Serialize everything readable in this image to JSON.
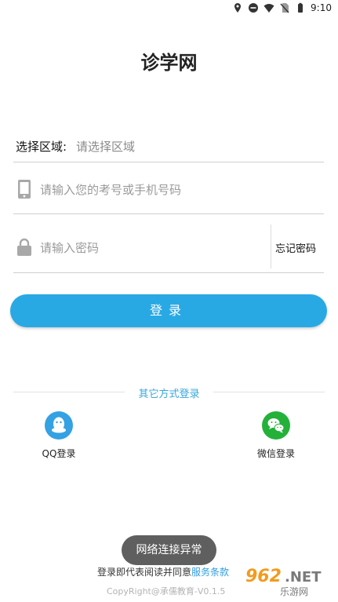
{
  "status_bar": {
    "time": "9:10",
    "icons": [
      "location-icon",
      "do-not-disturb-icon",
      "wifi-icon",
      "no-sim-icon",
      "battery-icon"
    ]
  },
  "header": {
    "title": "诊学网"
  },
  "form": {
    "region": {
      "label": "选择区域:",
      "placeholder": "请选择区域"
    },
    "account": {
      "placeholder": "请输入您的考号或手机号码",
      "icon": "phone-icon"
    },
    "password": {
      "placeholder": "请输入密码",
      "icon": "lock-icon",
      "forgot_label": "忘记密码"
    },
    "login_label": "登录"
  },
  "other_login": {
    "title": "其它方式登录",
    "options": [
      {
        "label": "QQ登录",
        "icon": "qq-icon",
        "color": "#34a1e3"
      },
      {
        "label": "微信登录",
        "icon": "wechat-icon",
        "color": "#23b13a"
      }
    ]
  },
  "toast": {
    "text": "网络连接异常"
  },
  "footer": {
    "agree_text": "登录即代表阅读并同意",
    "agree_link": "服务条款",
    "copyright": "CopyRight@承儒教育-V0.1.5"
  },
  "watermark": {
    "text": "962.NET",
    "subtext": "乐游网"
  },
  "colors": {
    "accent": "#29a9e4",
    "link": "#2f9de0",
    "qq": "#34a1e3",
    "wechat": "#23b13a"
  }
}
